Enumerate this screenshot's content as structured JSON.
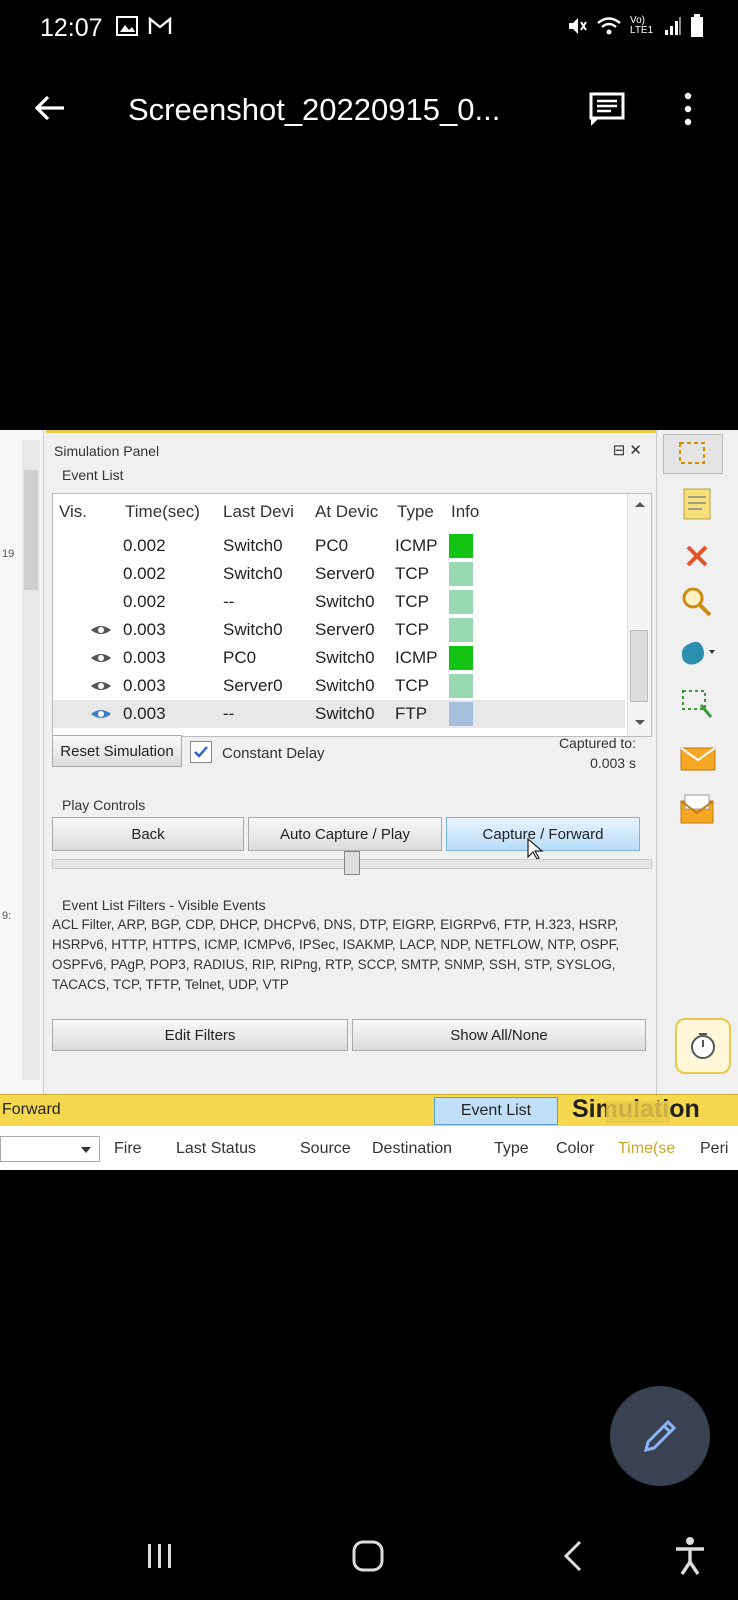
{
  "status_bar": {
    "time": "12:07",
    "network_label": "Vo) LTE1"
  },
  "app_bar": {
    "title": "Screenshot_20220915_0..."
  },
  "shot": {
    "stray_left": [
      "19",
      "9:"
    ],
    "panel": {
      "title": "Simulation Panel",
      "controls": "⊟ ✕",
      "event_list_label": "Event List",
      "columns": [
        "Vis.",
        "Time(sec)",
        "Last Devi",
        "At Devic",
        "Type",
        "Info"
      ],
      "rows": [
        {
          "vis": "",
          "time": "0.002",
          "last": "Switch0",
          "at": "PC0",
          "type": "ICMP",
          "color": "#13c413"
        },
        {
          "vis": "",
          "time": "0.002",
          "last": "Switch0",
          "at": "Server0",
          "type": "TCP",
          "color": "#9ad8b4"
        },
        {
          "vis": "",
          "time": "0.002",
          "last": "--",
          "at": "Switch0",
          "type": "TCP",
          "color": "#9ad8b4"
        },
        {
          "vis": "eye",
          "time": "0.003",
          "last": "Switch0",
          "at": "Server0",
          "type": "TCP",
          "color": "#9ad8b4"
        },
        {
          "vis": "eye",
          "time": "0.003",
          "last": "PC0",
          "at": "Switch0",
          "type": "ICMP",
          "color": "#13c413"
        },
        {
          "vis": "eye",
          "time": "0.003",
          "last": "Server0",
          "at": "Switch0",
          "type": "TCP",
          "color": "#9ad8b4"
        },
        {
          "vis": "eye-blue",
          "time": "0.003",
          "last": "--",
          "at": "Switch0",
          "type": "FTP",
          "color": "#a6bfdc"
        }
      ],
      "reset_label": "Reset Simulation",
      "constant_delay_label": "Constant Delay",
      "constant_delay_checked": true,
      "captured_to_label": "Captured to:",
      "captured_to_value": "0.003 s",
      "play_controls_label": "Play Controls",
      "back_label": "Back",
      "auto_label": "Auto Capture / Play",
      "capture_label": "Capture / Forward",
      "filters_label": "Event List Filters - Visible Events",
      "filters_text": "ACL Filter, ARP, BGP, CDP, DHCP, DHCPv6, DNS, DTP, EIGRP, EIGRPv6, FTP, H.323, HSRP, HSRPv6, HTTP, HTTPS, ICMP, ICMPv6, IPSec, ISAKMP, LACP, NDP, NETFLOW, NTP, OSPF, OSPFv6, PAgP, POP3, RADIUS, RIP, RIPng, RTP, SCCP, SMTP, SNMP, SSH, STP, SYSLOG, TACACS, TCP, TFTP, Telnet, UDP, VTP",
      "edit_filters_label": "Edit Filters",
      "show_all_label": "Show All/None"
    },
    "bottom_bar": {
      "forward_label": "Forward",
      "event_list_tab": "Event List",
      "simulation_label": "Simulation"
    },
    "table_columns": [
      "Fire",
      "Last Status",
      "Source",
      "Destination",
      "Type",
      "Color",
      "Time(se",
      "Peri"
    ]
  }
}
